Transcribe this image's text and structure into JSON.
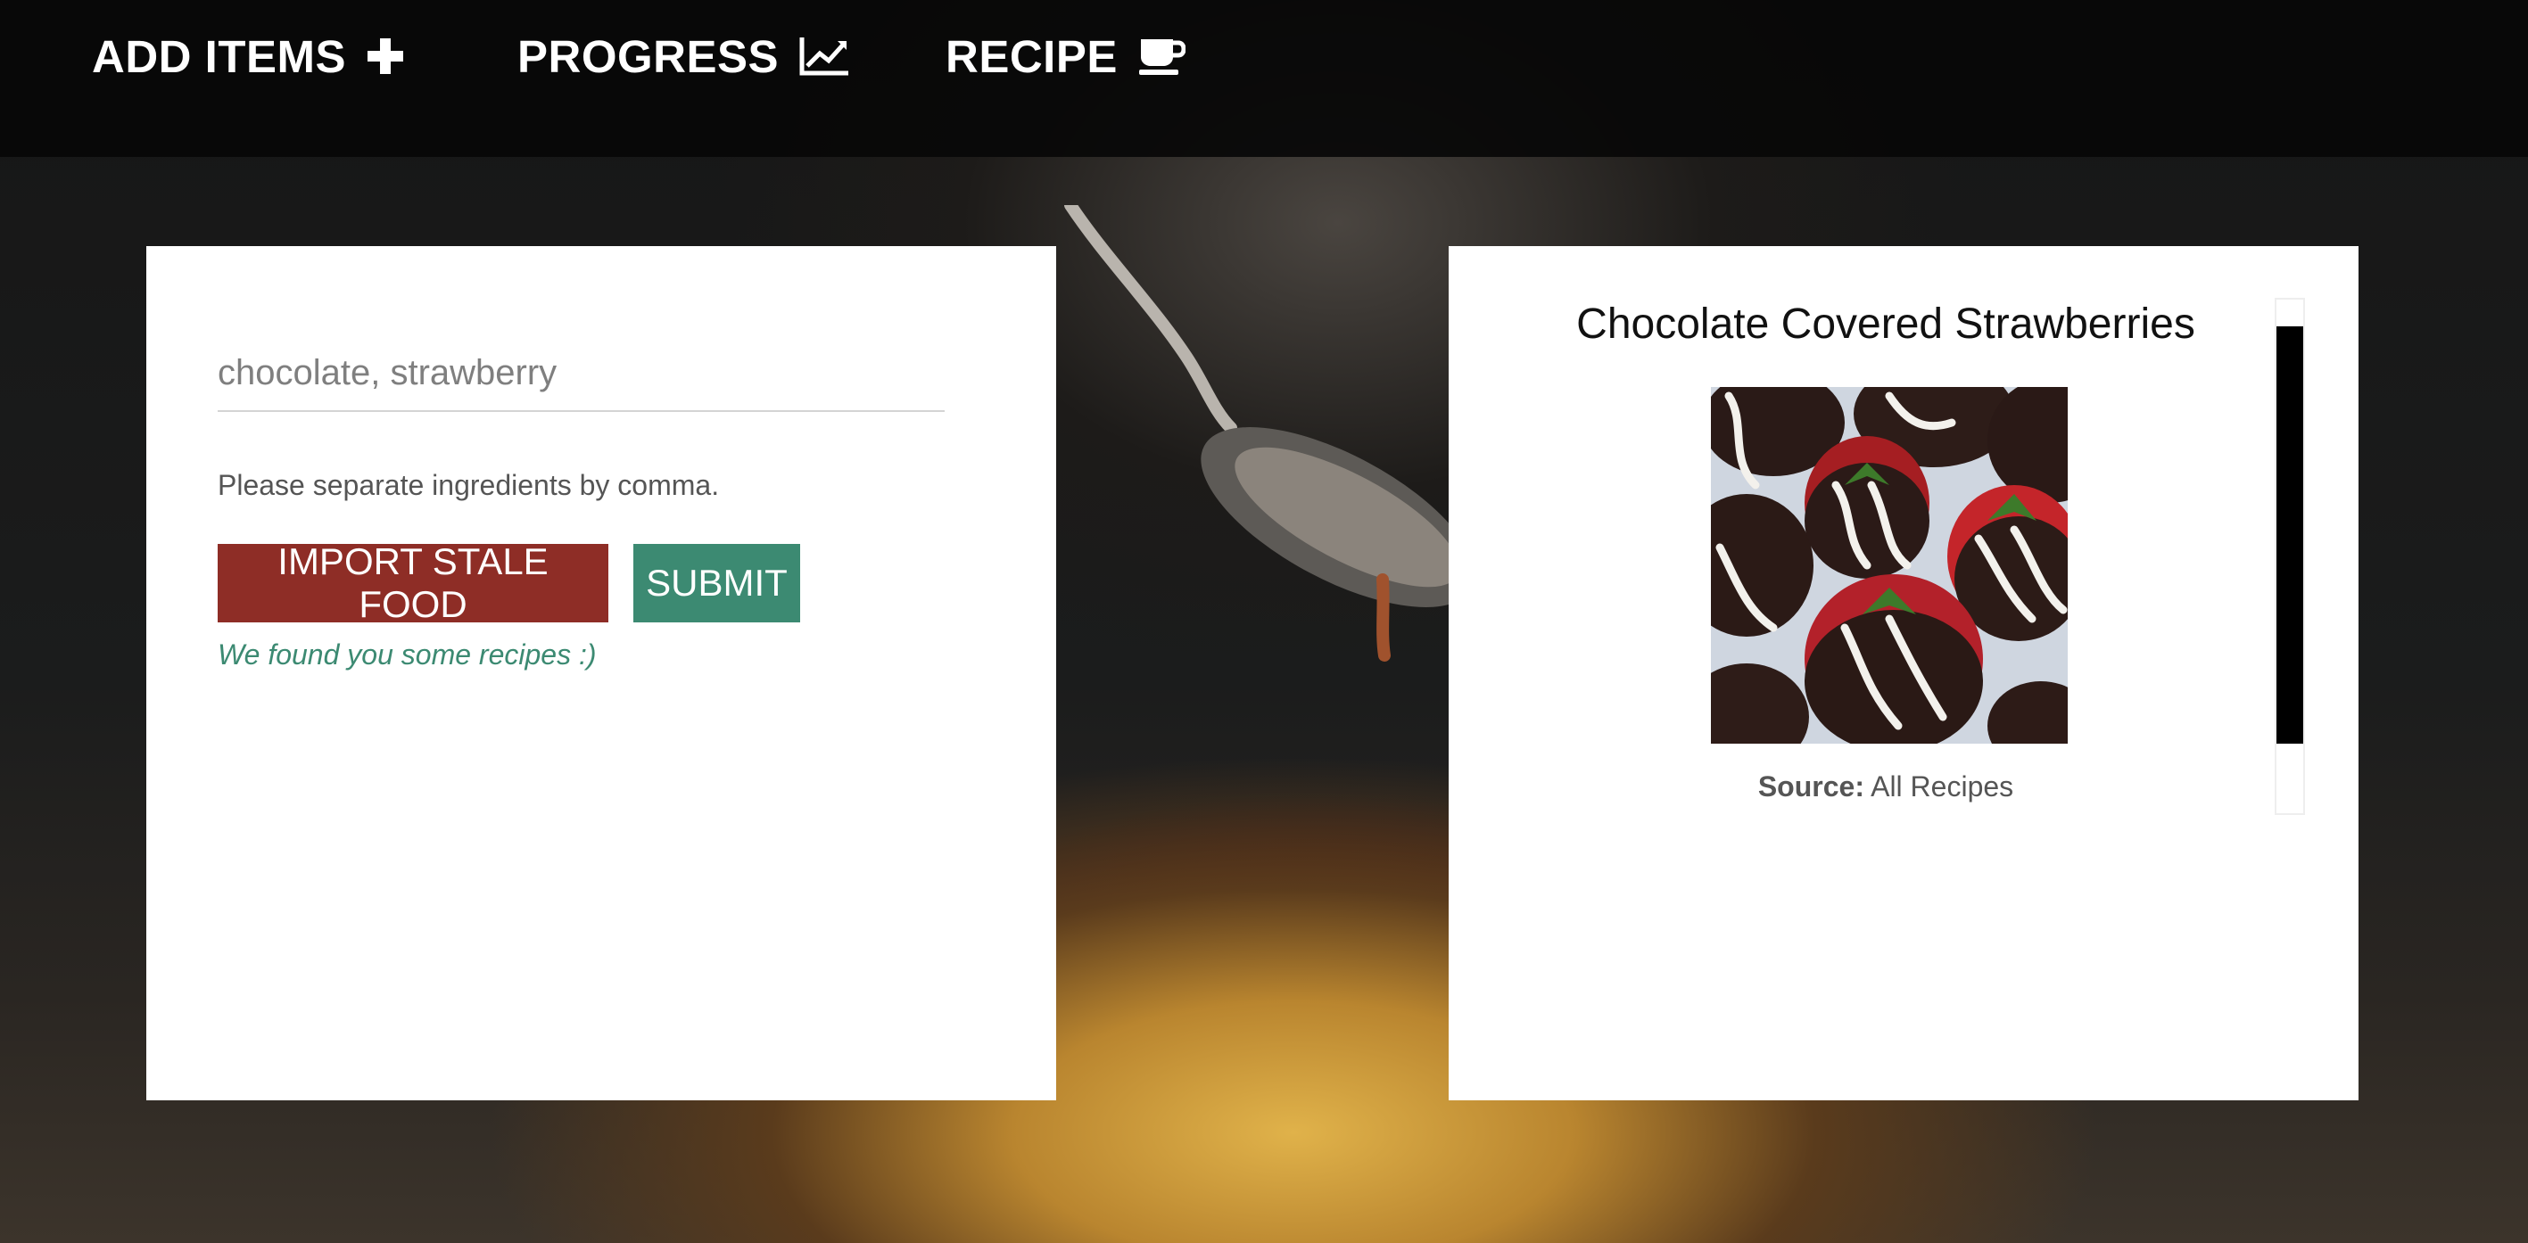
{
  "nav": {
    "items": [
      {
        "label": "ADD ITEMS",
        "icon": "plus-icon"
      },
      {
        "label": "PROGRESS",
        "icon": "line-chart-icon"
      },
      {
        "label": "RECIPE",
        "icon": "coffee-cup-icon"
      }
    ]
  },
  "search": {
    "value": "chocolate, strawberry",
    "helper": "Please separate ingredients by comma.",
    "import_label": "IMPORT STALE FOOD",
    "submit_label": "SUBMIT",
    "status": "We found you some recipes :)"
  },
  "recipe": {
    "title": "Chocolate Covered Strawberries",
    "source_label": "Source:",
    "source_value": "All Recipes"
  },
  "colors": {
    "import_button": "#8e2d26",
    "submit_button": "#3c8a72",
    "status_text": "#3c8a72",
    "navbar": "#080808"
  }
}
